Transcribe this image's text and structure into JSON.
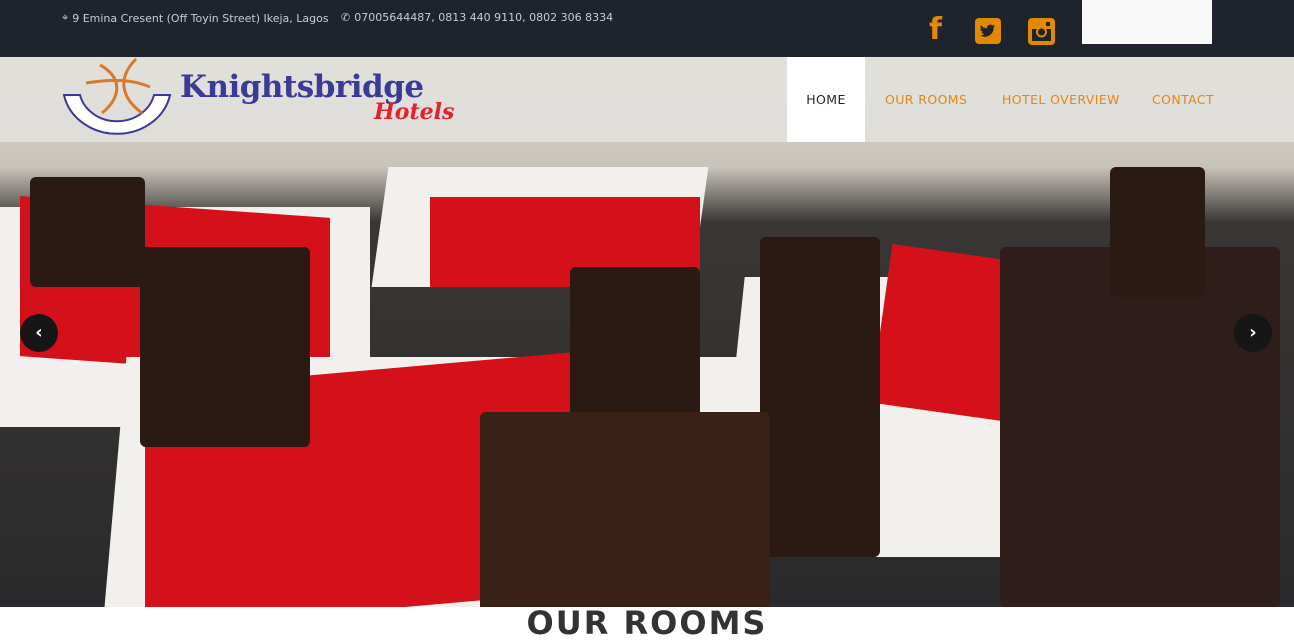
{
  "topbar": {
    "address": "9 Emina Cresent (Off Toyin Street) Ikeja, Lagos",
    "phones": "07005644487, 0813 440 9110, 0802 306 8334",
    "social": [
      "facebook-icon",
      "twitter-icon",
      "instagram-icon"
    ]
  },
  "logo": {
    "brand": "Knightsbridge",
    "sub": "Hotels",
    "ring": "KNIGHTSBRIDGE"
  },
  "nav": {
    "items": [
      {
        "label": "HOME",
        "active": true
      },
      {
        "label": "OUR ROOMS"
      },
      {
        "label": "HOTEL OVERVIEW"
      },
      {
        "label": "CONTACT"
      }
    ]
  },
  "slider": {
    "prev": "‹",
    "next": "›"
  },
  "section": {
    "title": "OUR ROOMS"
  },
  "colors": {
    "accent": "#e08a00",
    "topbar": "#1f232d",
    "brand_blue": "#3b3a96",
    "brand_red": "#e3202e"
  }
}
